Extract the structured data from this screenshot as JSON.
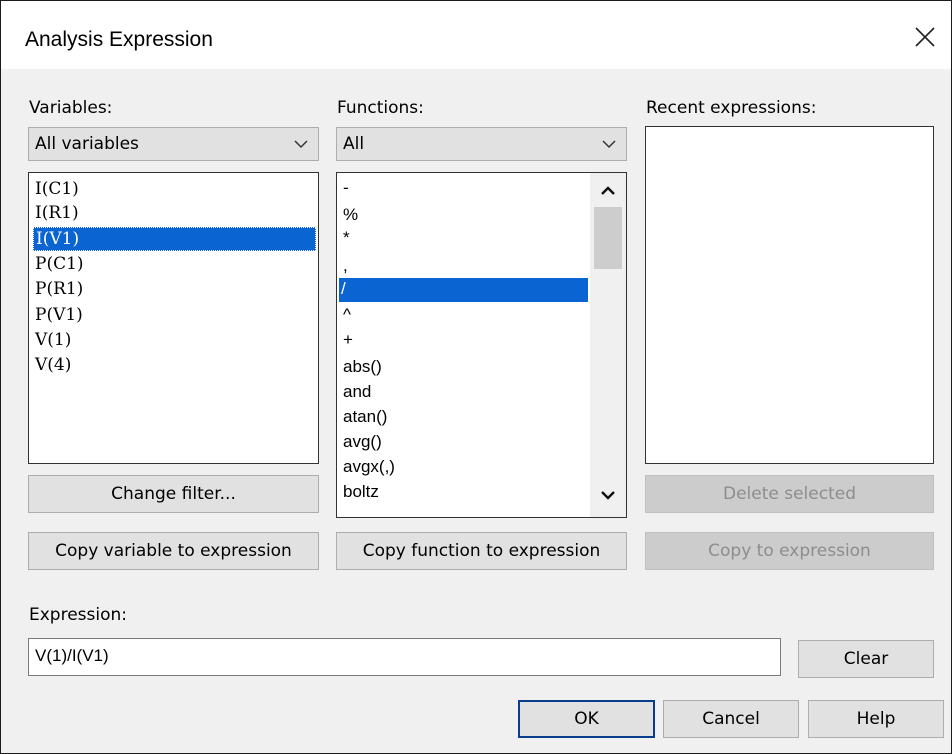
{
  "window": {
    "title": "Analysis Expression"
  },
  "variables": {
    "label": "Variables:",
    "filter_value": "All variables",
    "items": [
      "I(C1)",
      "I(R1)",
      "I(V1)",
      "P(C1)",
      "P(R1)",
      "P(V1)",
      "V(1)",
      "V(4)"
    ],
    "selected": "I(V1)",
    "change_filter_label": "Change filter...",
    "copy_label": "Copy variable to expression"
  },
  "functions": {
    "label": "Functions:",
    "filter_value": "All",
    "items": [
      "-",
      "%",
      "*",
      ",",
      "/",
      "^",
      "+",
      "abs()",
      "and",
      "atan()",
      "avg()",
      "avgx(,)",
      "boltz"
    ],
    "selected": "/",
    "copy_label": "Copy function to expression"
  },
  "recent": {
    "label": "Recent expressions:",
    "delete_label": "Delete selected",
    "copy_label": "Copy to expression"
  },
  "expression": {
    "label": "Expression:",
    "value": "V(1)/I(V1)",
    "clear_label": "Clear"
  },
  "footer": {
    "ok_label": "OK",
    "cancel_label": "Cancel",
    "help_label": "Help"
  }
}
